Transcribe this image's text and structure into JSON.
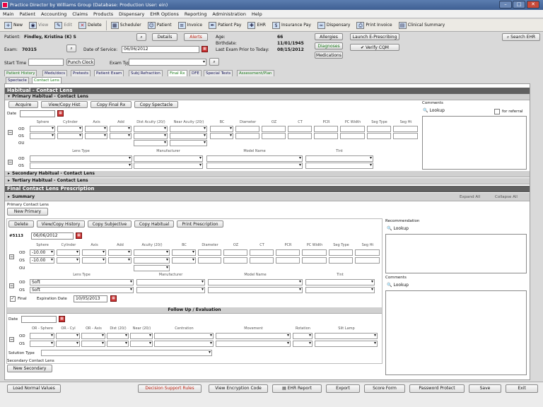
{
  "window": {
    "title": "Practice Director by Williams Group    (Database: Production   User: ein)"
  },
  "menu": [
    "Main",
    "Patient",
    "Accounting",
    "Claims",
    "Products",
    "Dispensary",
    "EHR Options",
    "Reporting",
    "Administration",
    "Help"
  ],
  "toolbar": [
    "New",
    "View",
    "Edit",
    "Delete",
    "Scheduler",
    "Patient",
    "Invoice",
    "Patient Pay",
    "EHR",
    "Insurance Pay",
    "Dispensary",
    "Print Invoice",
    "Clinical Summary"
  ],
  "patient": {
    "label": "Patient:",
    "name": "Findley, Kristina (K) S",
    "details": "Details",
    "alerts": "Alerts",
    "exam_label": "Exam:",
    "exam": "70315",
    "dos_label": "Date of Service:",
    "dos": "06/06/2012",
    "start_label": "Start Time",
    "punch_clock": "Punch Clock",
    "exam_type_label": "Exam Type",
    "age_label": "Age:",
    "age": "66",
    "birth_label": "Birthdate:",
    "birth": "11/01/1945",
    "last_exam_label": "Last Exam Prior to Today:",
    "last_exam": "08/15/2012",
    "allergies": "Allergies",
    "diagnoses": "Diagnoses",
    "medications": "Medications",
    "launch_erx": "Launch E-Prescribing",
    "verify_cqm": "Verify CQM",
    "search_ehr": "Search EHR"
  },
  "tabs": [
    "Patient History",
    "Meds/docs",
    "Pretests",
    "Patient Exam",
    "Subj Refraction",
    "Final Rx",
    "DFE",
    "Special Tests",
    "Assessment/Plan"
  ],
  "subtabs": [
    "Spectacle",
    "Contact Lens"
  ],
  "habitual": {
    "header": "Habitual - Contact Lens",
    "primary": "Primary Habitual - Contact Lens",
    "acquire": "Acquire",
    "view_copy": "View/Copy Hist",
    "copy_final": "Copy Final Rx",
    "copy_spect": "Copy Spectacle",
    "date_label": "Date",
    "columns": [
      "Sphere",
      "Cylinder",
      "Axis",
      "Add",
      "Dist Acuity (20/)",
      "Near Acuity (20/)",
      "BC",
      "Diameter",
      "OZ",
      "CT",
      "PCR",
      "PC Width",
      "Seg Type",
      "Seg Ht"
    ],
    "eyes": [
      "OD",
      "OS",
      "OU"
    ],
    "lens_cols": [
      "Lens Type",
      "Manufacturer",
      "Model Name",
      "Tint"
    ],
    "comments": "Comments",
    "lookup": "Lookup",
    "for_referral": "for referral",
    "secondary": "Secondary Habitual - Contact Lens",
    "tertiary": "Tertiary Habitual - Contact Lens"
  },
  "final": {
    "header": "Final Contact Lens Prescription",
    "summary": "Summary",
    "expand": "Expand All",
    "collapse": "Collapse All",
    "primary_label": "Primary Contact Lens",
    "new_primary": "New Primary",
    "delete": "Delete",
    "view_copy": "View/Copy History",
    "copy_subj": "Copy Subjective",
    "copy_hab": "Copy Habitual",
    "print_rx": "Print Prescription",
    "rx_id": "#5113",
    "rx_date": "06/06/2012",
    "columns": [
      "Sphere",
      "Cylinder",
      "Axis",
      "Add",
      "Acuity (20/)",
      "BC",
      "Diameter",
      "OZ",
      "CT",
      "PCR",
      "PC Width",
      "Seg Type",
      "Seg Ht"
    ],
    "od_sphere": "-10.00",
    "os_sphere": "-10.00",
    "lens_type_od": "Soft",
    "lens_type_os": "Soft",
    "final_chk": "Final",
    "exp_label": "Expiration Date",
    "exp_date": "10/05/2013",
    "recommendation": "Recommendation",
    "comments": "Comments",
    "lookup": "Lookup",
    "followup": "Follow Up / Evaluation",
    "fu_cols": [
      "OR - Sphere",
      "OR - Cyl",
      "OR - Axis",
      "Dist (20/)",
      "Near (20/)",
      "Centration",
      "Movement",
      "Rotation",
      "Slit Lamp"
    ],
    "solution": "Solution Type",
    "secondary_label": "Secondary Contact Lens",
    "new_secondary": "New Secondary"
  },
  "bottom": [
    "Load Normal Values",
    "Decision Support Rules",
    "View Encryption Code",
    "EHR Report",
    "Export",
    "Score Form",
    "Password Protect",
    "Save",
    "Exit"
  ]
}
